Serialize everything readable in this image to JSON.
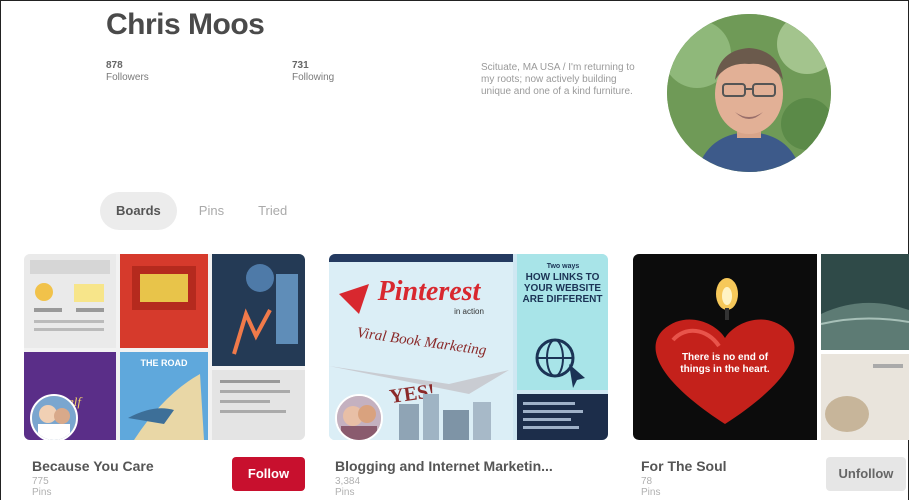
{
  "profile": {
    "name": "Chris Moos",
    "followers_count": "878",
    "followers_label": "Followers",
    "following_count": "731",
    "following_label": "Following",
    "bio": "Scituate, MA USA / I'm returning to my roots; now actively building unique and one of a kind furniture."
  },
  "tabs": [
    {
      "label": "Boards",
      "active": true
    },
    {
      "label": "Pins",
      "active": false
    },
    {
      "label": "Tried",
      "active": false
    }
  ],
  "boards": [
    {
      "title": "Because You Care",
      "pins": "775 Pins",
      "button": "Follow",
      "cover_text": [
        "THE ROAD",
        "self"
      ]
    },
    {
      "title": "Blogging and Internet Marketin...",
      "pins": "3,384 Pins",
      "cover_text": [
        "Pinterest",
        "in action",
        "Viral Book Marketing",
        "YES!",
        "HOW LINKS TO YOUR WEBSITE ARE DIFFERENT",
        "Two ways"
      ]
    },
    {
      "title": "For The Soul",
      "pins": "78 Pins",
      "button": "Unfollow",
      "cover_text": [
        "There is no end of things in the heart."
      ]
    }
  ],
  "colors": {
    "follow_button": "#c8102e",
    "unfollow_button": "#e6e6e6",
    "active_tab_bg": "#ececec"
  }
}
